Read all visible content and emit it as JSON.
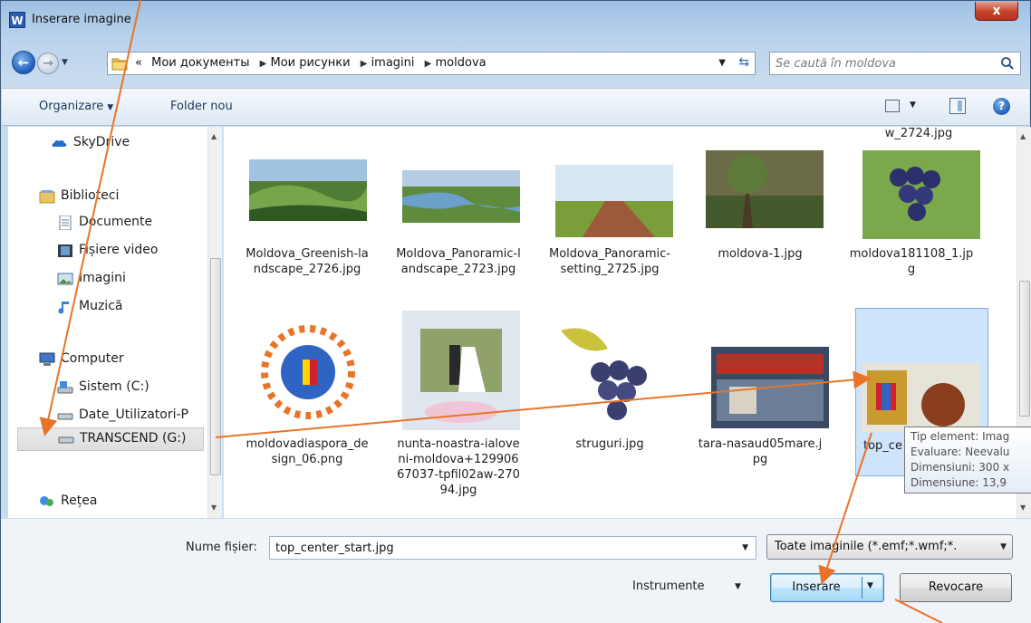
{
  "window": {
    "title": "Inserare imagine",
    "app_icon_letter": "W",
    "close_symbol": "x"
  },
  "address": {
    "prefix": "«",
    "breadcrumbs": [
      "Мои документы",
      "Мои рисунки",
      "imagini",
      "moldova"
    ],
    "separator": "▶"
  },
  "search": {
    "placeholder": "Se caută în moldova"
  },
  "toolbar": {
    "organize_label": "Organizare",
    "new_folder_label": "Folder nou",
    "help_symbol": "?"
  },
  "nav_pane": {
    "items": [
      {
        "label": "SkyDrive",
        "icon": "skydrive-icon"
      },
      {
        "label": "Biblioteci",
        "icon": "libraries-icon"
      },
      {
        "label": "Documente",
        "icon": "documents-icon"
      },
      {
        "label": "Fișiere video",
        "icon": "video-icon"
      },
      {
        "label": "Imagini",
        "icon": "pictures-icon"
      },
      {
        "label": "Muzică",
        "icon": "music-icon"
      },
      {
        "label": "Computer",
        "icon": "computer-icon"
      },
      {
        "label": "Sistem (C:)",
        "icon": "system-drive-icon"
      },
      {
        "label": "Date_Utilizatori-P",
        "icon": "drive-icon"
      },
      {
        "label": "TRANSCEND (G:)",
        "icon": "usb-drive-icon"
      },
      {
        "label": "Rețea",
        "icon": "network-icon"
      }
    ]
  },
  "files": {
    "partial_top": "w_2724.jpg",
    "items": [
      {
        "name": "Moldova_Greenish-landscape_2726.jpg"
      },
      {
        "name": "Moldova_Panoramic-landscape_2723.jpg"
      },
      {
        "name": "Moldova_Panoramic-setting_2725.jpg"
      },
      {
        "name": "moldova-1.jpg"
      },
      {
        "name": "moldova181108_1.jpg"
      },
      {
        "name": "moldovadiaspora_design_06.png"
      },
      {
        "name": "nunta-noastra-ialoveni-moldova+12990667037-tpfil02aw-27094.jpg"
      },
      {
        "name": "struguri.jpg"
      },
      {
        "name": "tara-nasaud05mare.jpg"
      },
      {
        "name": "top_ce"
      }
    ]
  },
  "tooltip": {
    "lines": [
      "Tip element: Imag",
      "Evaluare: Neevalu",
      "Dimensiuni: 300 x",
      "Dimensiune: 13,9"
    ]
  },
  "bottom": {
    "filename_label": "Nume fișier:",
    "filename_value": "top_center_start.jpg",
    "filetype_value": "Toate imaginile (*.emf;*.wmf;*.",
    "tools_label": "Instrumente",
    "insert_label": "Inserare",
    "cancel_label": "Revocare"
  },
  "colors": {
    "annotation_arrow": "#e8742a",
    "selection": "#cde4fb",
    "close_button": "#c3432b"
  }
}
